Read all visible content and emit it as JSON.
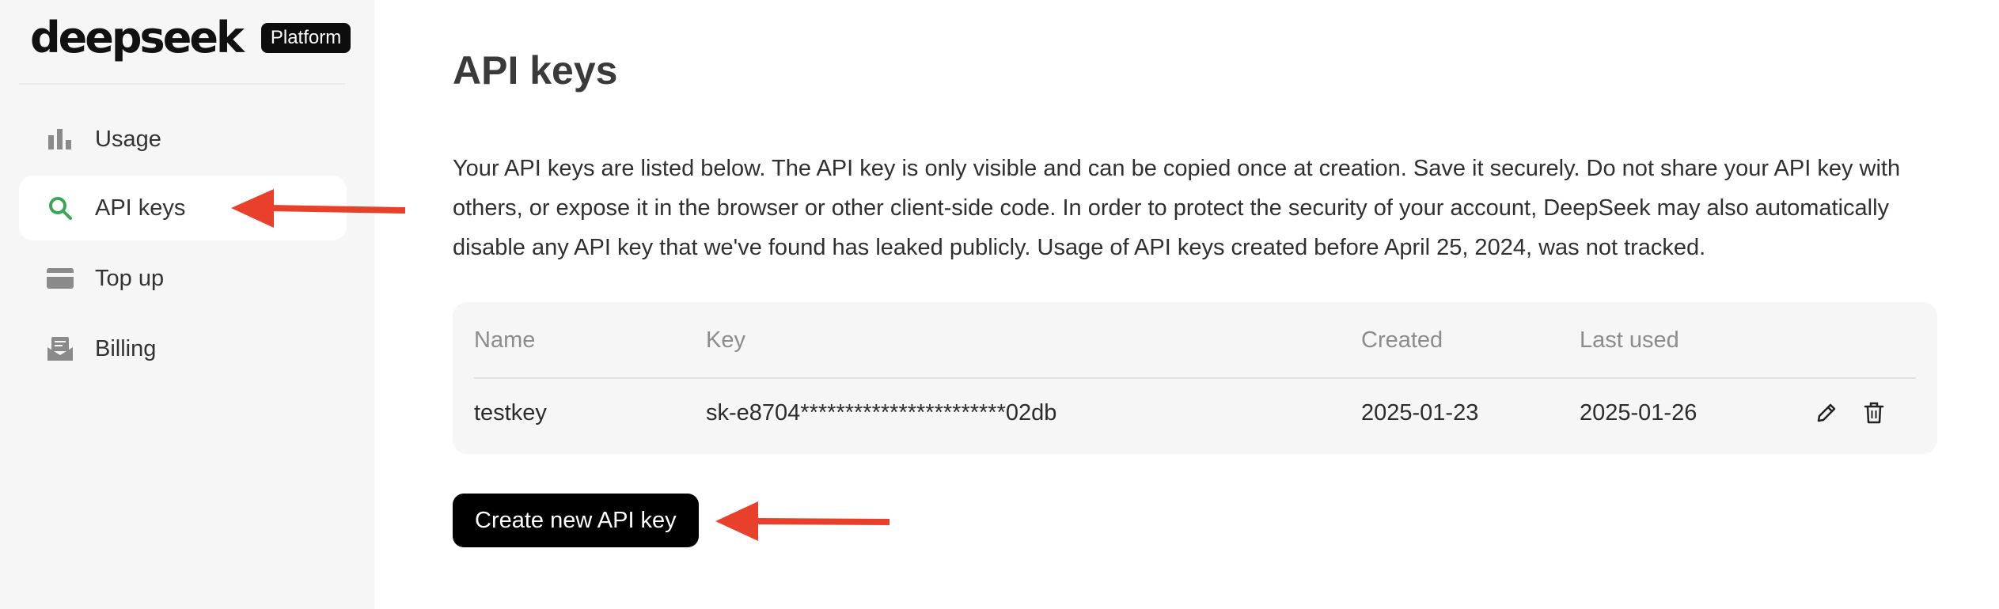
{
  "brand": {
    "logo_text": "deepseek",
    "badge": "Platform"
  },
  "sidebar": {
    "items": [
      {
        "label": "Usage",
        "icon": "bar-chart-icon",
        "active": false
      },
      {
        "label": "API keys",
        "icon": "search-icon",
        "active": true
      },
      {
        "label": "Top up",
        "icon": "card-icon",
        "active": false
      },
      {
        "label": "Billing",
        "icon": "billing-icon",
        "active": false
      }
    ]
  },
  "main": {
    "title": "API keys",
    "description": "Your API keys are listed below. The API key is only visible and can be copied once at creation. Save it securely. Do not share your API key with others, or expose it in the browser or other client-side code. In order to protect the security of your account, DeepSeek may also automatically disable any API key that we've found has leaked publicly. Usage of API keys created before April 25, 2024, was not tracked.",
    "table": {
      "headers": {
        "name": "Name",
        "key": "Key",
        "created": "Created",
        "last_used": "Last used"
      },
      "rows": [
        {
          "name": "testkey",
          "key": "sk-e8704***********************02db",
          "created": "2025-01-23",
          "last_used": "2025-01-26",
          "actions": [
            "edit-icon",
            "trash-icon"
          ]
        }
      ]
    },
    "create_button": "Create new API key"
  },
  "annotations": {
    "arrow_color": "#e8402a"
  },
  "colors": {
    "active_icon": "#3aa757",
    "icon_gray": "#8a8a8a",
    "button_bg": "#000000"
  }
}
